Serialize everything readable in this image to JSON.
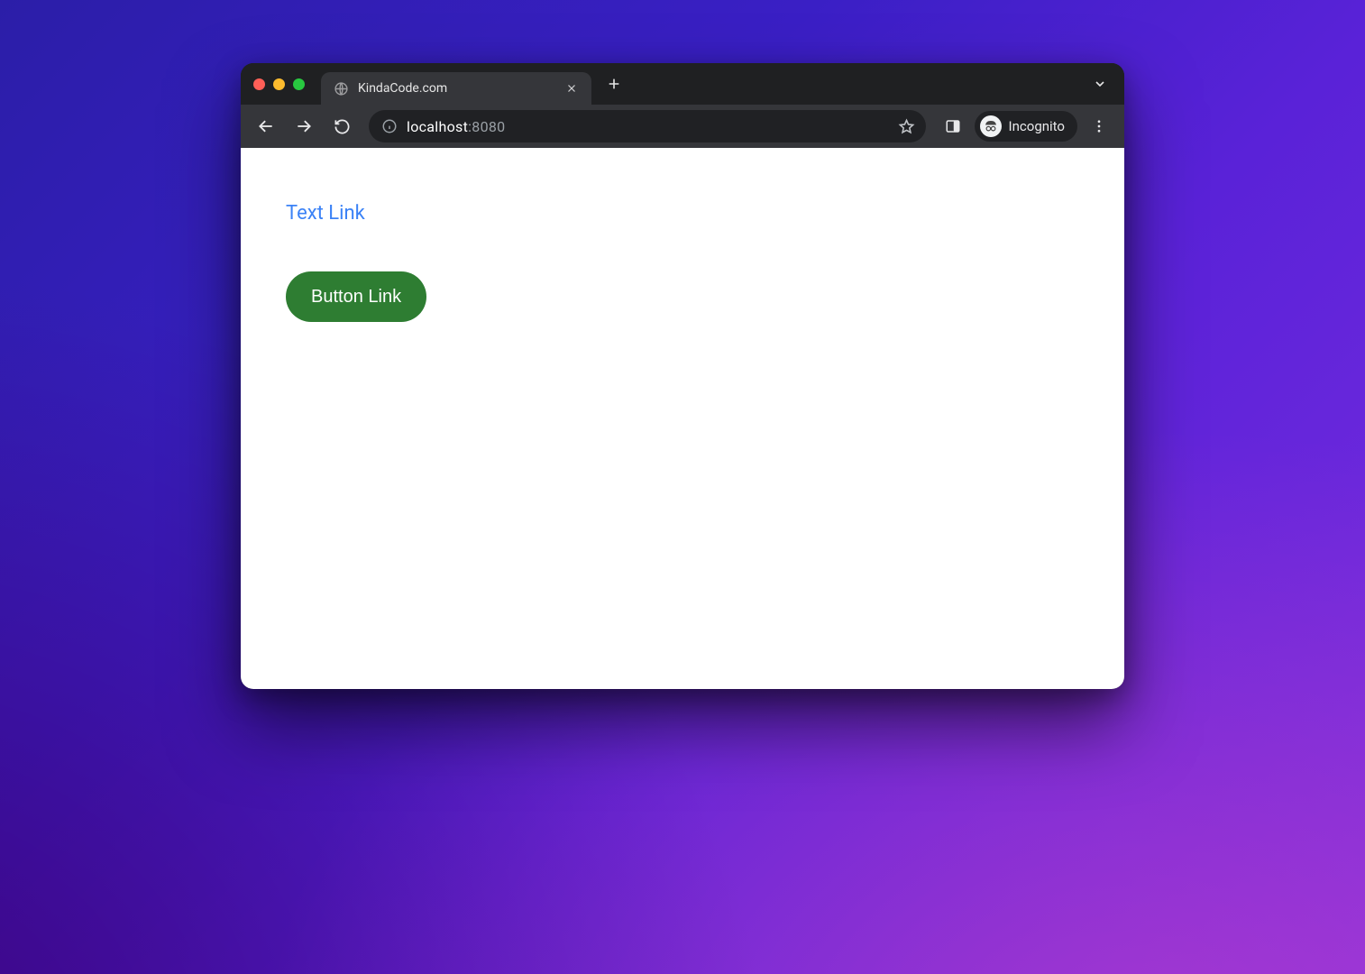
{
  "tab": {
    "title": "KindaCode.com"
  },
  "address": {
    "host": "localhost",
    "port": ":8080"
  },
  "incognito_label": "Incognito",
  "page": {
    "text_link_label": "Text Link",
    "button_link_label": "Button Link"
  },
  "colors": {
    "link": "#3b82f6",
    "button_bg": "#2e7d32"
  }
}
